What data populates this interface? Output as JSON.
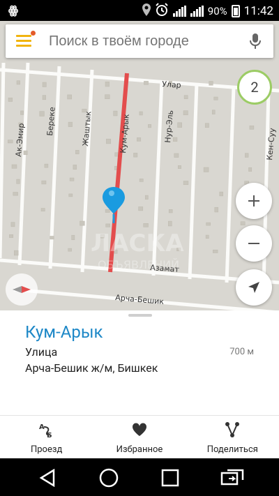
{
  "status_bar": {
    "battery": "90%",
    "time": "11:42"
  },
  "search": {
    "placeholder": "Поиск в твоём городе"
  },
  "map": {
    "cluster_count": "2",
    "street_labels": [
      "Улар",
      "Ак-Эмир",
      "Береке",
      "Жаштык",
      "Кум-Арык",
      "Нур-Эль",
      "Кен-Суу",
      "Азамат",
      "Арча-Бешик"
    ],
    "watermark": "ЛАСКА / ОБЪЯВЛЕНИЙ",
    "accent_route_color": "#e34d4d",
    "pin_color": "#1a9be0",
    "zoom_in_icon": "plus-icon",
    "zoom_out_icon": "minus-icon",
    "locate_icon": "navigation-arrow-icon"
  },
  "place": {
    "title": "Кум-Арык",
    "type": "Улица",
    "distance": "700 м",
    "address": "Арча-Бешик ж/м, Бишкек"
  },
  "actions": [
    {
      "label": "Проезд",
      "icon": "route-icon"
    },
    {
      "label": "Избранное",
      "icon": "heart-icon"
    },
    {
      "label": "Поделиться",
      "icon": "share-icon"
    }
  ],
  "colors": {
    "title_blue": "#1e88c7",
    "menu_yellow": "#f1b40f",
    "badge_green": "#9ccc65"
  }
}
